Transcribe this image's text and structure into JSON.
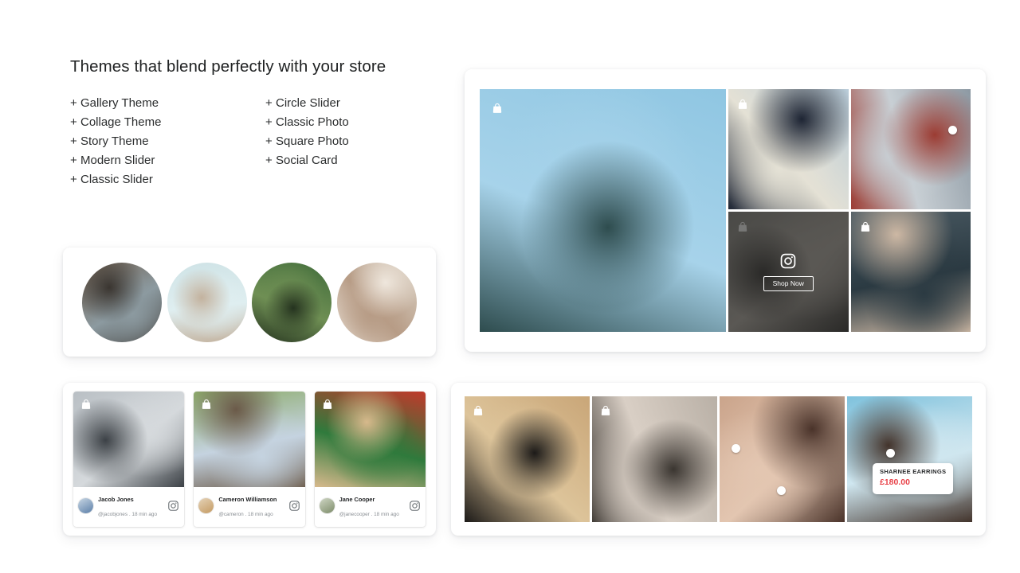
{
  "intro": {
    "title": "Themes that blend perfectly with your store",
    "columns": [
      {
        "items": [
          "Gallery Theme",
          "Collage Theme",
          "Story Theme",
          "Modern Slider",
          "Classic Slider"
        ]
      },
      {
        "items": [
          "Circle Slider",
          "Classic Photo",
          "Square Photo",
          "Social Card"
        ]
      }
    ],
    "bullet": "+"
  },
  "circle_slider": {
    "name": "circle-slider-theme",
    "items": [
      {
        "label": "watch-in-hand-stream",
        "colors": [
          "#6d5b4a",
          "#8c9aa0",
          "#3a3530"
        ]
      },
      {
        "label": "watch-on-wrist-sky",
        "colors": [
          "#cfe3e6",
          "#dfeef0",
          "#c3b29e"
        ]
      },
      {
        "label": "watch-leaves-closeup",
        "colors": [
          "#3f6b3a",
          "#6f8f54",
          "#25331f"
        ]
      },
      {
        "label": "woman-hat-street",
        "colors": [
          "#d9cfc2",
          "#b79c86",
          "#efe7dd"
        ]
      }
    ]
  },
  "collage": {
    "name": "collage-theme",
    "cells": [
      {
        "label": "man-headphones-sky",
        "shoppable": true,
        "colors": [
          "#8fc6e2",
          "#a7d3ea",
          "#2e4c4e"
        ]
      },
      {
        "label": "woman-headphones-city",
        "shoppable": true,
        "colors": [
          "#b8cbd8",
          "#e4e1d5",
          "#1d2433"
        ]
      },
      {
        "label": "woman-headphones-tram",
        "shoppable": false,
        "hotspot": true,
        "colors": [
          "#8d99a3",
          "#c8cfd4",
          "#9c3c33"
        ]
      },
      {
        "label": "woman-headphones-cafe",
        "shoppable": true,
        "overlay": true,
        "colors": [
          "#6d6a63",
          "#8b857c",
          "#34312c"
        ]
      },
      {
        "label": "woman-blue-headphones",
        "shoppable": true,
        "colors": [
          "#4a5a63",
          "#2b3a42",
          "#cdb8a4"
        ]
      }
    ],
    "overlay": {
      "shop_now_label": "Shop Now",
      "icon": "instagram-icon"
    }
  },
  "social_cards": {
    "name": "social-card-theme",
    "icon": "instagram-icon",
    "cards": [
      {
        "name": "Jacob Jones",
        "handle": "@jacobjones",
        "separator": ".",
        "time": "18 min ago",
        "shoppable": true,
        "image_label": "woman-peace-sign-door",
        "colors": [
          "#b9bfc4",
          "#d5d9dc",
          "#3c4146"
        ],
        "avatar_colors": [
          "#5b7fa8",
          "#c9d7e4"
        ]
      },
      {
        "name": "Cameron Williamson",
        "handle": "@cameron",
        "separator": ".",
        "time": "18 min ago",
        "shoppable": true,
        "image_label": "child-on-steps-street",
        "colors": [
          "#8cab6a",
          "#c5d3e0",
          "#6b5a49"
        ],
        "avatar_colors": [
          "#c49a62",
          "#e5d3b8"
        ]
      },
      {
        "name": "Jane Cooper",
        "handle": "@janecooper",
        "separator": ".",
        "time": "18 min ago",
        "shoppable": true,
        "image_label": "woman-peacock-chair-red",
        "colors": [
          "#c0392b",
          "#2f7a3c",
          "#d7b98c"
        ],
        "avatar_colors": [
          "#7d8c6a",
          "#cfd6c4"
        ]
      }
    ]
  },
  "square_photo": {
    "name": "square-photo-theme",
    "cells": [
      {
        "label": "woman-desert-black-dress",
        "shoppable": true,
        "colors": [
          "#c9a678",
          "#ddc49a",
          "#1c1a18"
        ]
      },
      {
        "label": "two-women-earrings",
        "shoppable": true,
        "colors": [
          "#b9b0a6",
          "#d9cfc5",
          "#3a3530"
        ]
      },
      {
        "label": "woman-choker-necklace",
        "shoppable": false,
        "hotspot": true,
        "colors": [
          "#caa48b",
          "#e3c6b1",
          "#4a332a"
        ]
      },
      {
        "label": "woman-beach-earrings",
        "shoppable": false,
        "hotspot": true,
        "tag": true,
        "colors": [
          "#7fc2dd",
          "#cfe6ef",
          "#43342c"
        ]
      }
    ],
    "product_tag": {
      "name": "SHARNEE EARRINGS",
      "price": "£180.00",
      "price_color": "#e8434a"
    }
  }
}
